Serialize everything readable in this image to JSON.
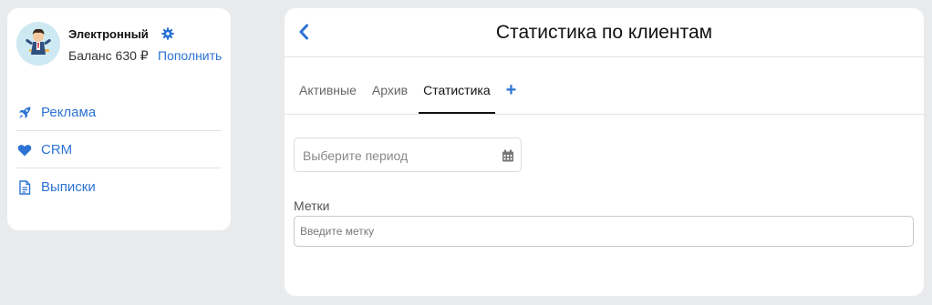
{
  "profile": {
    "name": "Электронный",
    "balance": "Баланс 630 ₽",
    "topup_label": "Пополнить",
    "verified_icon": "gear-icon",
    "accent": "#2d73d6"
  },
  "sidebar": {
    "items": [
      {
        "label": "Реклама",
        "icon": "rocket-icon"
      },
      {
        "label": "CRM",
        "icon": "heart-icon"
      },
      {
        "label": "Выписки",
        "icon": "document-icon"
      }
    ]
  },
  "header": {
    "title": "Статистика по клиентам",
    "back_icon": "chevron-left-icon"
  },
  "tabs": {
    "items": [
      {
        "label": "Активные",
        "active": false
      },
      {
        "label": "Архив",
        "active": false
      },
      {
        "label": "Статистика",
        "active": true
      }
    ],
    "add_label": "+"
  },
  "filters": {
    "period_placeholder": "Выберите период",
    "period_icon": "calendar-icon",
    "tags_label": "Метки",
    "tags_placeholder": "Введите метку",
    "tags_value": ""
  }
}
